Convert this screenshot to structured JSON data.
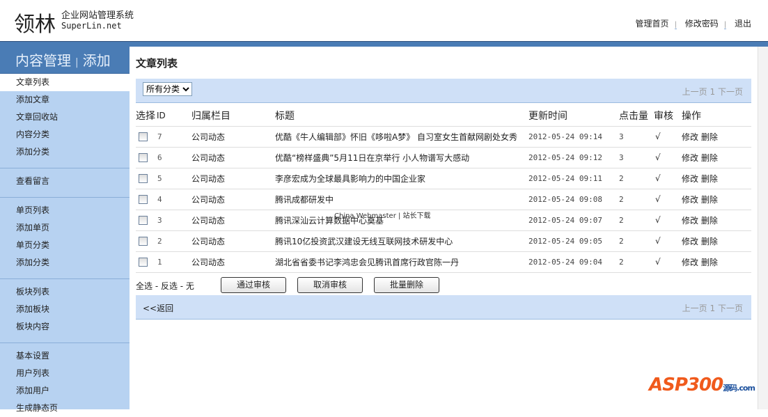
{
  "brand": {
    "name": "领林",
    "subtitle": "企业网站管理系统",
    "domain": "SuperLin.net"
  },
  "topnav": [
    "管理首页",
    "修改密码",
    "退出"
  ],
  "sidebar": {
    "title": "内容管理",
    "title_sep": "|",
    "add": "添加",
    "groups": [
      [
        "文章列表",
        "添加文章",
        "文章回收站",
        "内容分类",
        "添加分类"
      ],
      [
        "查看留言"
      ],
      [
        "单页列表",
        "添加单页",
        "单页分类",
        "添加分类"
      ],
      [
        "板块列表",
        "添加板块",
        "板块内容"
      ],
      [
        "基本设置",
        "用户列表",
        "添加用户",
        "生成静态页"
      ]
    ]
  },
  "main": {
    "title": "文章列表",
    "filter": "所有分类",
    "pager": {
      "prev": "上一页",
      "page": "1",
      "next": "下一页"
    },
    "columns": [
      "选择",
      "ID",
      "归属栏目",
      "标题",
      "更新时间",
      "点击量",
      "审核",
      "操作"
    ],
    "rows": [
      {
        "id": "7",
        "cat": "公司动态",
        "title": "优酷《牛人编辑部》怀旧《哆啦A梦》 自习室女生首献网剧处女秀",
        "time": "2012-05-24 09:14",
        "hits": "3",
        "ok": "√"
      },
      {
        "id": "6",
        "cat": "公司动态",
        "title": "优酷“榜样盛典”5月11日在京举行 小人物谱写大感动",
        "time": "2012-05-24 09:12",
        "hits": "3",
        "ok": "√"
      },
      {
        "id": "5",
        "cat": "公司动态",
        "title": "李彦宏成为全球最具影响力的中国企业家",
        "time": "2012-05-24 09:11",
        "hits": "2",
        "ok": "√"
      },
      {
        "id": "4",
        "cat": "公司动态",
        "title": "腾讯成都研发中",
        "time": "2012-05-24 09:08",
        "hits": "2",
        "ok": "√"
      },
      {
        "id": "3",
        "cat": "公司动态",
        "title": "腾讯深汕云计算数据中心奠基",
        "time": "2012-05-24 09:07",
        "hits": "2",
        "ok": "√"
      },
      {
        "id": "2",
        "cat": "公司动态",
        "title": "腾讯10亿投资武汉建设无线互联网技术研发中心",
        "time": "2012-05-24 09:05",
        "hits": "2",
        "ok": "√"
      },
      {
        "id": "1",
        "cat": "公司动态",
        "title": "湖北省省委书记李鸿忠会见腾讯首席行政官陈一丹",
        "time": "2012-05-24 09:04",
        "hits": "2",
        "ok": "√"
      }
    ],
    "edit": "修改",
    "delete": "删除",
    "select": "全选 - 反选 - 无",
    "buttons": [
      "通过审核",
      "取消审核",
      "批量删除"
    ],
    "back": "<<返回"
  },
  "watermark": "China Webmaster | 站长下载",
  "corner_logo": {
    "text": "ASP300",
    "suffix": "源码.com"
  }
}
